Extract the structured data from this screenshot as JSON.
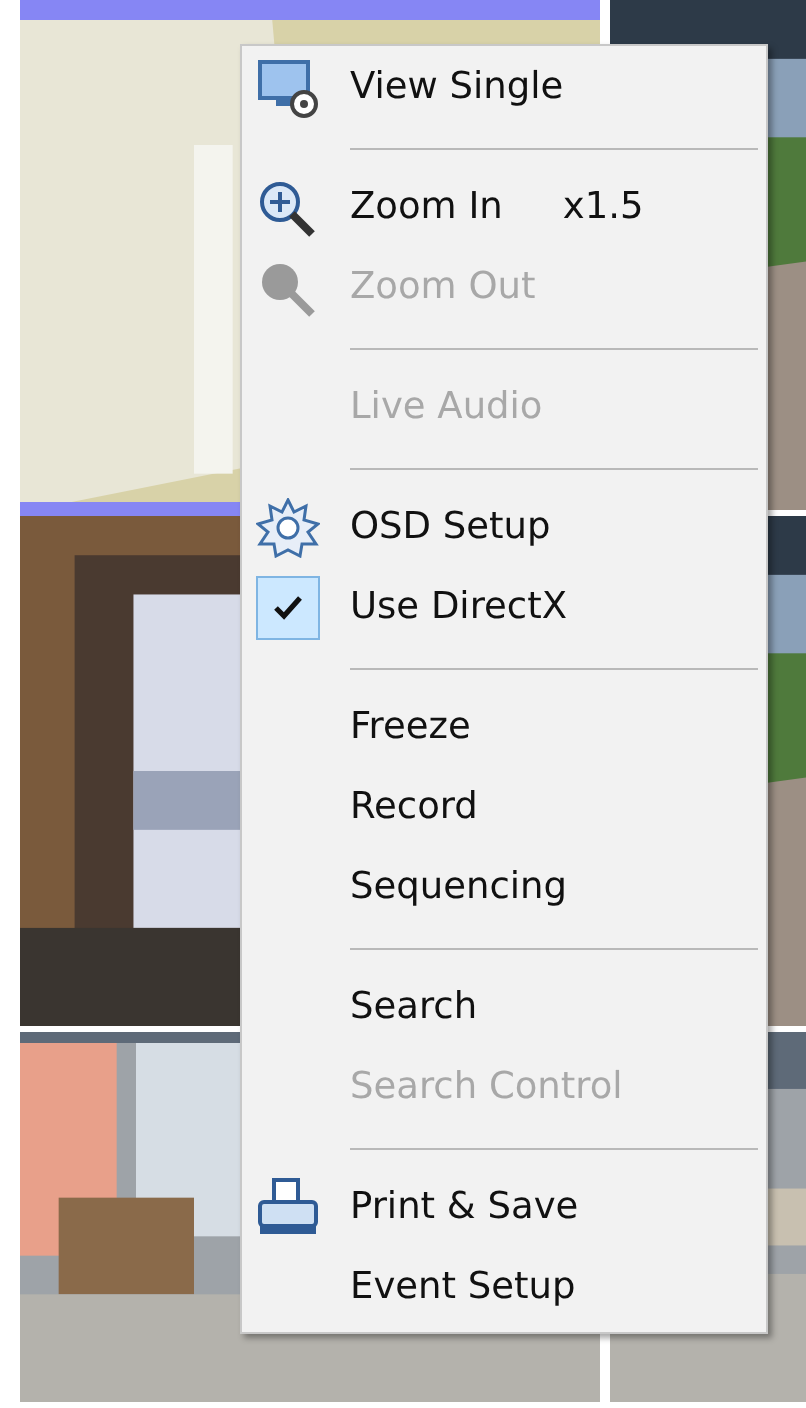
{
  "camera_tiles": [
    {
      "kind": "picture",
      "selected": true
    },
    {
      "kind": "picture",
      "selected": false
    },
    {
      "kind": "picture",
      "selected": false
    },
    {
      "kind": "picture",
      "selected": false
    },
    {
      "kind": "picture",
      "selected": false
    },
    {
      "kind": "picture",
      "selected": false
    }
  ],
  "context_menu": {
    "items": [
      {
        "kind": "item",
        "label": "View Single",
        "disabled": false
      },
      {
        "kind": "separator"
      },
      {
        "kind": "item",
        "label": "Zoom In",
        "shortcut": "x1.5",
        "disabled": false
      },
      {
        "kind": "item",
        "label": "Zoom Out",
        "disabled": true
      },
      {
        "kind": "separator"
      },
      {
        "kind": "item",
        "label": "Live Audio",
        "disabled": true
      },
      {
        "kind": "separator"
      },
      {
        "kind": "item",
        "label": "OSD Setup",
        "disabled": false
      },
      {
        "kind": "item",
        "label": "Use DirectX",
        "disabled": false,
        "checked": true
      },
      {
        "kind": "separator"
      },
      {
        "kind": "item",
        "label": "Freeze",
        "disabled": false
      },
      {
        "kind": "item",
        "label": "Record",
        "disabled": false
      },
      {
        "kind": "item",
        "label": "Sequencing",
        "disabled": false
      },
      {
        "kind": "separator"
      },
      {
        "kind": "item",
        "label": "Search",
        "disabled": false
      },
      {
        "kind": "item",
        "label": "Search Control",
        "disabled": true
      },
      {
        "kind": "separator"
      },
      {
        "kind": "item",
        "label": "Print & Save",
        "disabled": false
      },
      {
        "kind": "item",
        "label": "Event Setup",
        "disabled": false
      }
    ]
  }
}
